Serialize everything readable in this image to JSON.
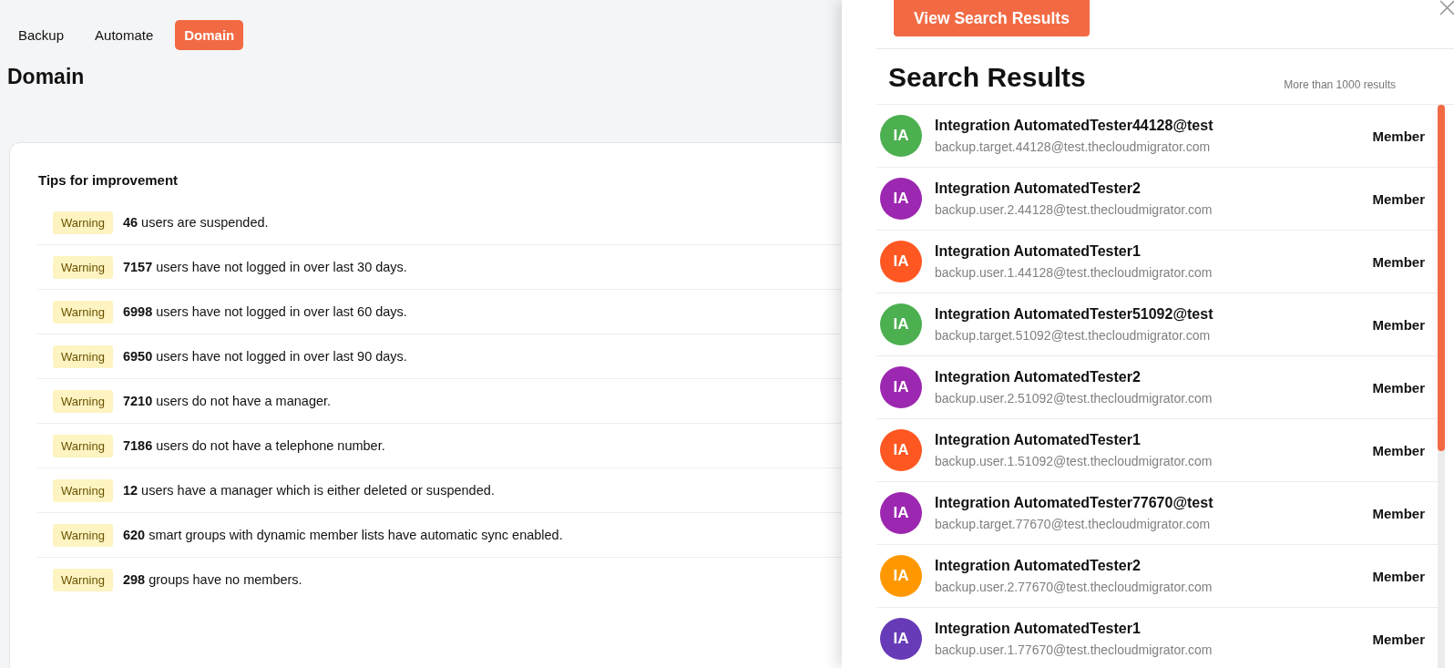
{
  "tabs": [
    {
      "label": "Backup",
      "selected": false
    },
    {
      "label": "Automate",
      "selected": false
    },
    {
      "label": "Domain",
      "selected": true
    }
  ],
  "page_title": "Domain",
  "tips": {
    "title": "Tips for improvement",
    "items": [
      {
        "badge": "Warning",
        "count": "46",
        "text": "users are suspended."
      },
      {
        "badge": "Warning",
        "count": "7157",
        "text": "users have not logged in over last 30 days."
      },
      {
        "badge": "Warning",
        "count": "6998",
        "text": "users have not logged in over last 60 days."
      },
      {
        "badge": "Warning",
        "count": "6950",
        "text": "users have not logged in over last 90 days."
      },
      {
        "badge": "Warning",
        "count": "7210",
        "text": "users do not have a manager."
      },
      {
        "badge": "Warning",
        "count": "7186",
        "text": "users do not have a telephone number."
      },
      {
        "badge": "Warning",
        "count": "12",
        "text": "users have a manager which is either deleted or suspended."
      },
      {
        "badge": "Warning",
        "count": "620",
        "text": "smart groups with dynamic member lists have automatic sync enabled."
      },
      {
        "badge": "Warning",
        "count": "298",
        "text": "groups have no members."
      }
    ]
  },
  "drawer": {
    "button": "View Search Results",
    "title": "Search Results",
    "count": "More than 1000 results",
    "results": [
      {
        "initials": "IA",
        "color": "#4caf50",
        "name": "Integration AutomatedTester44128@test",
        "email": "backup.target.44128@test.thecloudmigrator.com",
        "role": "Member"
      },
      {
        "initials": "IA",
        "color": "#9c27b0",
        "name": "Integration AutomatedTester2",
        "email": "backup.user.2.44128@test.thecloudmigrator.com",
        "role": "Member"
      },
      {
        "initials": "IA",
        "color": "#ff5722",
        "name": "Integration AutomatedTester1",
        "email": "backup.user.1.44128@test.thecloudmigrator.com",
        "role": "Member"
      },
      {
        "initials": "IA",
        "color": "#4caf50",
        "name": "Integration AutomatedTester51092@test",
        "email": "backup.target.51092@test.thecloudmigrator.com",
        "role": "Member"
      },
      {
        "initials": "IA",
        "color": "#9c27b0",
        "name": "Integration AutomatedTester2",
        "email": "backup.user.2.51092@test.thecloudmigrator.com",
        "role": "Member"
      },
      {
        "initials": "IA",
        "color": "#ff5722",
        "name": "Integration AutomatedTester1",
        "email": "backup.user.1.51092@test.thecloudmigrator.com",
        "role": "Member"
      },
      {
        "initials": "IA",
        "color": "#9c27b0",
        "name": "Integration AutomatedTester77670@test",
        "email": "backup.target.77670@test.thecloudmigrator.com",
        "role": "Member"
      },
      {
        "initials": "IA",
        "color": "#ff9800",
        "name": "Integration AutomatedTester2",
        "email": "backup.user.2.77670@test.thecloudmigrator.com",
        "role": "Member"
      },
      {
        "initials": "IA",
        "color": "#673ab7",
        "name": "Integration AutomatedTester1",
        "email": "backup.user.1.77670@test.thecloudmigrator.com",
        "role": "Member"
      }
    ]
  }
}
